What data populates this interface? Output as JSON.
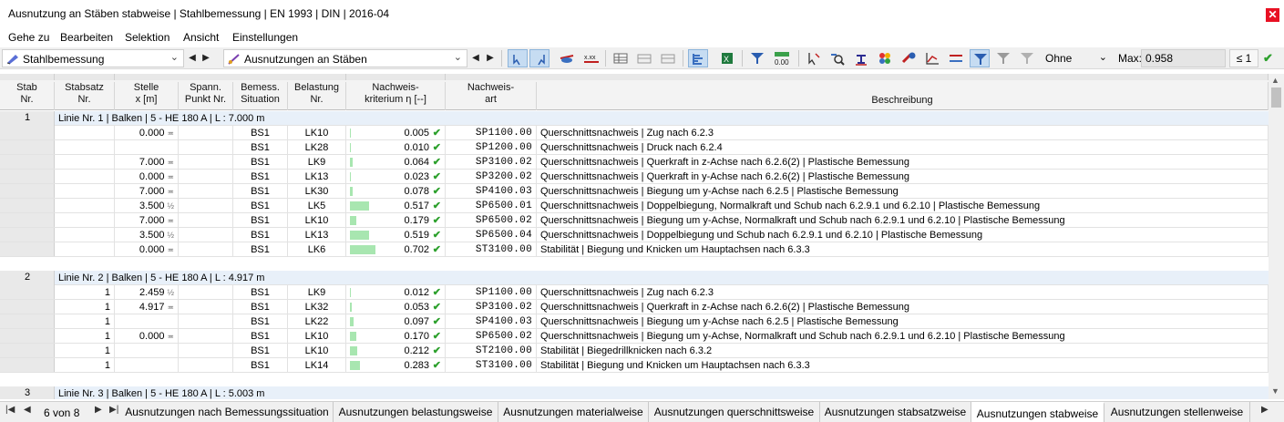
{
  "window": {
    "title": "Ausnutzung an Stäben stabweise | Stahlbemessung | EN 1993 | DIN | 2016-04",
    "close_glyph": "✕"
  },
  "menu": [
    "Gehe zu",
    "Bearbeiten",
    "Selektion",
    "Ansicht",
    "Einstellungen"
  ],
  "toolbar": {
    "module_combo": "Stahlbemessung",
    "result_combo": "Ausnutzungen an Stäben",
    "filter_combo": "Ohne",
    "max_label": "Max:",
    "max_value": "0.958",
    "limit_label": "≤ 1",
    "status_check": "✔"
  },
  "columns": {
    "stab": "Stab\nNr.",
    "stabsatz": "Stabsatz\nNr.",
    "stelle": "Stelle\nx [m]",
    "spann": "Spann.\nPunkt Nr.",
    "bemess": "Bemess.\nSituation",
    "belastung": "Belastung\nNr.",
    "krit": "Nachweis-\nkriterium η [--]",
    "art": "Nachweis-\nart",
    "besch": "Beschreibung"
  },
  "groups": [
    {
      "stab": "1",
      "label": "Linie Nr. 1 | Balken | 5 - HE 180 A | L : 7.000 m",
      "rows": [
        {
          "stabsatz": "",
          "stelle": "0.000",
          "sym": "≖",
          "bs": "BS1",
          "lk": "LK10",
          "eta": "0.005",
          "frac": 0.005,
          "art": "SP1100.00",
          "desc": "Querschnittsnachweis | Zug nach 6.2.3"
        },
        {
          "stabsatz": "",
          "stelle": "",
          "sym": "",
          "bs": "BS1",
          "lk": "LK28",
          "eta": "0.010",
          "frac": 0.01,
          "art": "SP1200.00",
          "desc": "Querschnittsnachweis | Druck nach 6.2.4"
        },
        {
          "stabsatz": "",
          "stelle": "7.000",
          "sym": "≖",
          "bs": "BS1",
          "lk": "LK9",
          "eta": "0.064",
          "frac": 0.064,
          "art": "SP3100.02",
          "desc": "Querschnittsnachweis | Querkraft in z-Achse nach 6.2.6(2) | Plastische Bemessung"
        },
        {
          "stabsatz": "",
          "stelle": "0.000",
          "sym": "≖",
          "bs": "BS1",
          "lk": "LK13",
          "eta": "0.023",
          "frac": 0.023,
          "art": "SP3200.02",
          "desc": "Querschnittsnachweis | Querkraft in y-Achse nach 6.2.6(2) | Plastische Bemessung"
        },
        {
          "stabsatz": "",
          "stelle": "7.000",
          "sym": "≖",
          "bs": "BS1",
          "lk": "LK30",
          "eta": "0.078",
          "frac": 0.078,
          "art": "SP4100.03",
          "desc": "Querschnittsnachweis | Biegung um y-Achse nach 6.2.5 | Plastische Bemessung"
        },
        {
          "stabsatz": "",
          "stelle": "3.500",
          "sym": "½",
          "bs": "BS1",
          "lk": "LK5",
          "eta": "0.517",
          "frac": 0.517,
          "art": "SP6500.01",
          "desc": "Querschnittsnachweis | Doppelbiegung, Normalkraft und Schub nach 6.2.9.1 und 6.2.10 | Plastische Bemessung"
        },
        {
          "stabsatz": "",
          "stelle": "7.000",
          "sym": "≖",
          "bs": "BS1",
          "lk": "LK10",
          "eta": "0.179",
          "frac": 0.179,
          "art": "SP6500.02",
          "desc": "Querschnittsnachweis | Biegung um y-Achse, Normalkraft und Schub nach 6.2.9.1 und 6.2.10 | Plastische Bemessung"
        },
        {
          "stabsatz": "",
          "stelle": "3.500",
          "sym": "½",
          "bs": "BS1",
          "lk": "LK13",
          "eta": "0.519",
          "frac": 0.519,
          "art": "SP6500.04",
          "desc": "Querschnittsnachweis | Doppelbiegung und Schub nach 6.2.9.1 und 6.2.10 | Plastische Bemessung"
        },
        {
          "stabsatz": "",
          "stelle": "0.000",
          "sym": "≖",
          "bs": "BS1",
          "lk": "LK6",
          "eta": "0.702",
          "frac": 0.702,
          "art": "ST3100.00",
          "desc": "Stabilität | Biegung und Knicken um Hauptachsen nach 6.3.3"
        }
      ]
    },
    {
      "stab": "2",
      "label": "Linie Nr. 2 | Balken | 5 - HE 180 A | L : 4.917 m",
      "rows": [
        {
          "stabsatz": "1",
          "stelle": "2.459",
          "sym": "½",
          "bs": "BS1",
          "lk": "LK9",
          "eta": "0.012",
          "frac": 0.012,
          "art": "SP1100.00",
          "desc": "Querschnittsnachweis | Zug nach 6.2.3"
        },
        {
          "stabsatz": "1",
          "stelle": "4.917",
          "sym": "≖",
          "bs": "BS1",
          "lk": "LK32",
          "eta": "0.053",
          "frac": 0.053,
          "art": "SP3100.02",
          "desc": "Querschnittsnachweis | Querkraft in z-Achse nach 6.2.6(2) | Plastische Bemessung"
        },
        {
          "stabsatz": "1",
          "stelle": "",
          "sym": "",
          "bs": "BS1",
          "lk": "LK22",
          "eta": "0.097",
          "frac": 0.097,
          "art": "SP4100.03",
          "desc": "Querschnittsnachweis | Biegung um y-Achse nach 6.2.5 | Plastische Bemessung"
        },
        {
          "stabsatz": "1",
          "stelle": "0.000",
          "sym": "≖",
          "bs": "BS1",
          "lk": "LK10",
          "eta": "0.170",
          "frac": 0.17,
          "art": "SP6500.02",
          "desc": "Querschnittsnachweis | Biegung um y-Achse, Normalkraft und Schub nach 6.2.9.1 und 6.2.10 | Plastische Bemessung"
        },
        {
          "stabsatz": "1",
          "stelle": "",
          "sym": "",
          "bs": "BS1",
          "lk": "LK10",
          "eta": "0.212",
          "frac": 0.212,
          "art": "ST2100.00",
          "desc": "Stabilität | Biegedrillknicken nach 6.3.2"
        },
        {
          "stabsatz": "1",
          "stelle": "",
          "sym": "",
          "bs": "BS1",
          "lk": "LK14",
          "eta": "0.283",
          "frac": 0.283,
          "art": "ST3100.00",
          "desc": "Stabilität | Biegung und Knicken um Hauptachsen nach 6.3.3"
        }
      ]
    },
    {
      "stab": "3",
      "label": "Linie Nr. 3 | Balken | 5 - HE 180 A | L : 5.003 m",
      "rows": []
    }
  ],
  "pager": {
    "text": "6 von 8"
  },
  "tabs": [
    {
      "label": "Ausnutzungen nach Bemessungssituation",
      "active": false
    },
    {
      "label": "Ausnutzungen belastungsweise",
      "active": false
    },
    {
      "label": "Ausnutzungen materialweise",
      "active": false
    },
    {
      "label": "Ausnutzungen querschnittsweise",
      "active": false
    },
    {
      "label": "Ausnutzungen stabsatzweise",
      "active": false
    },
    {
      "label": "Ausnutzungen stabweise",
      "active": true
    },
    {
      "label": "Ausnutzungen stellenweise",
      "active": false
    }
  ],
  "colors": {
    "bar": "#a8e6b0",
    "check": "#2ca02c",
    "group_row": "#e8f0f9",
    "active_button": "#c6dcf2"
  }
}
